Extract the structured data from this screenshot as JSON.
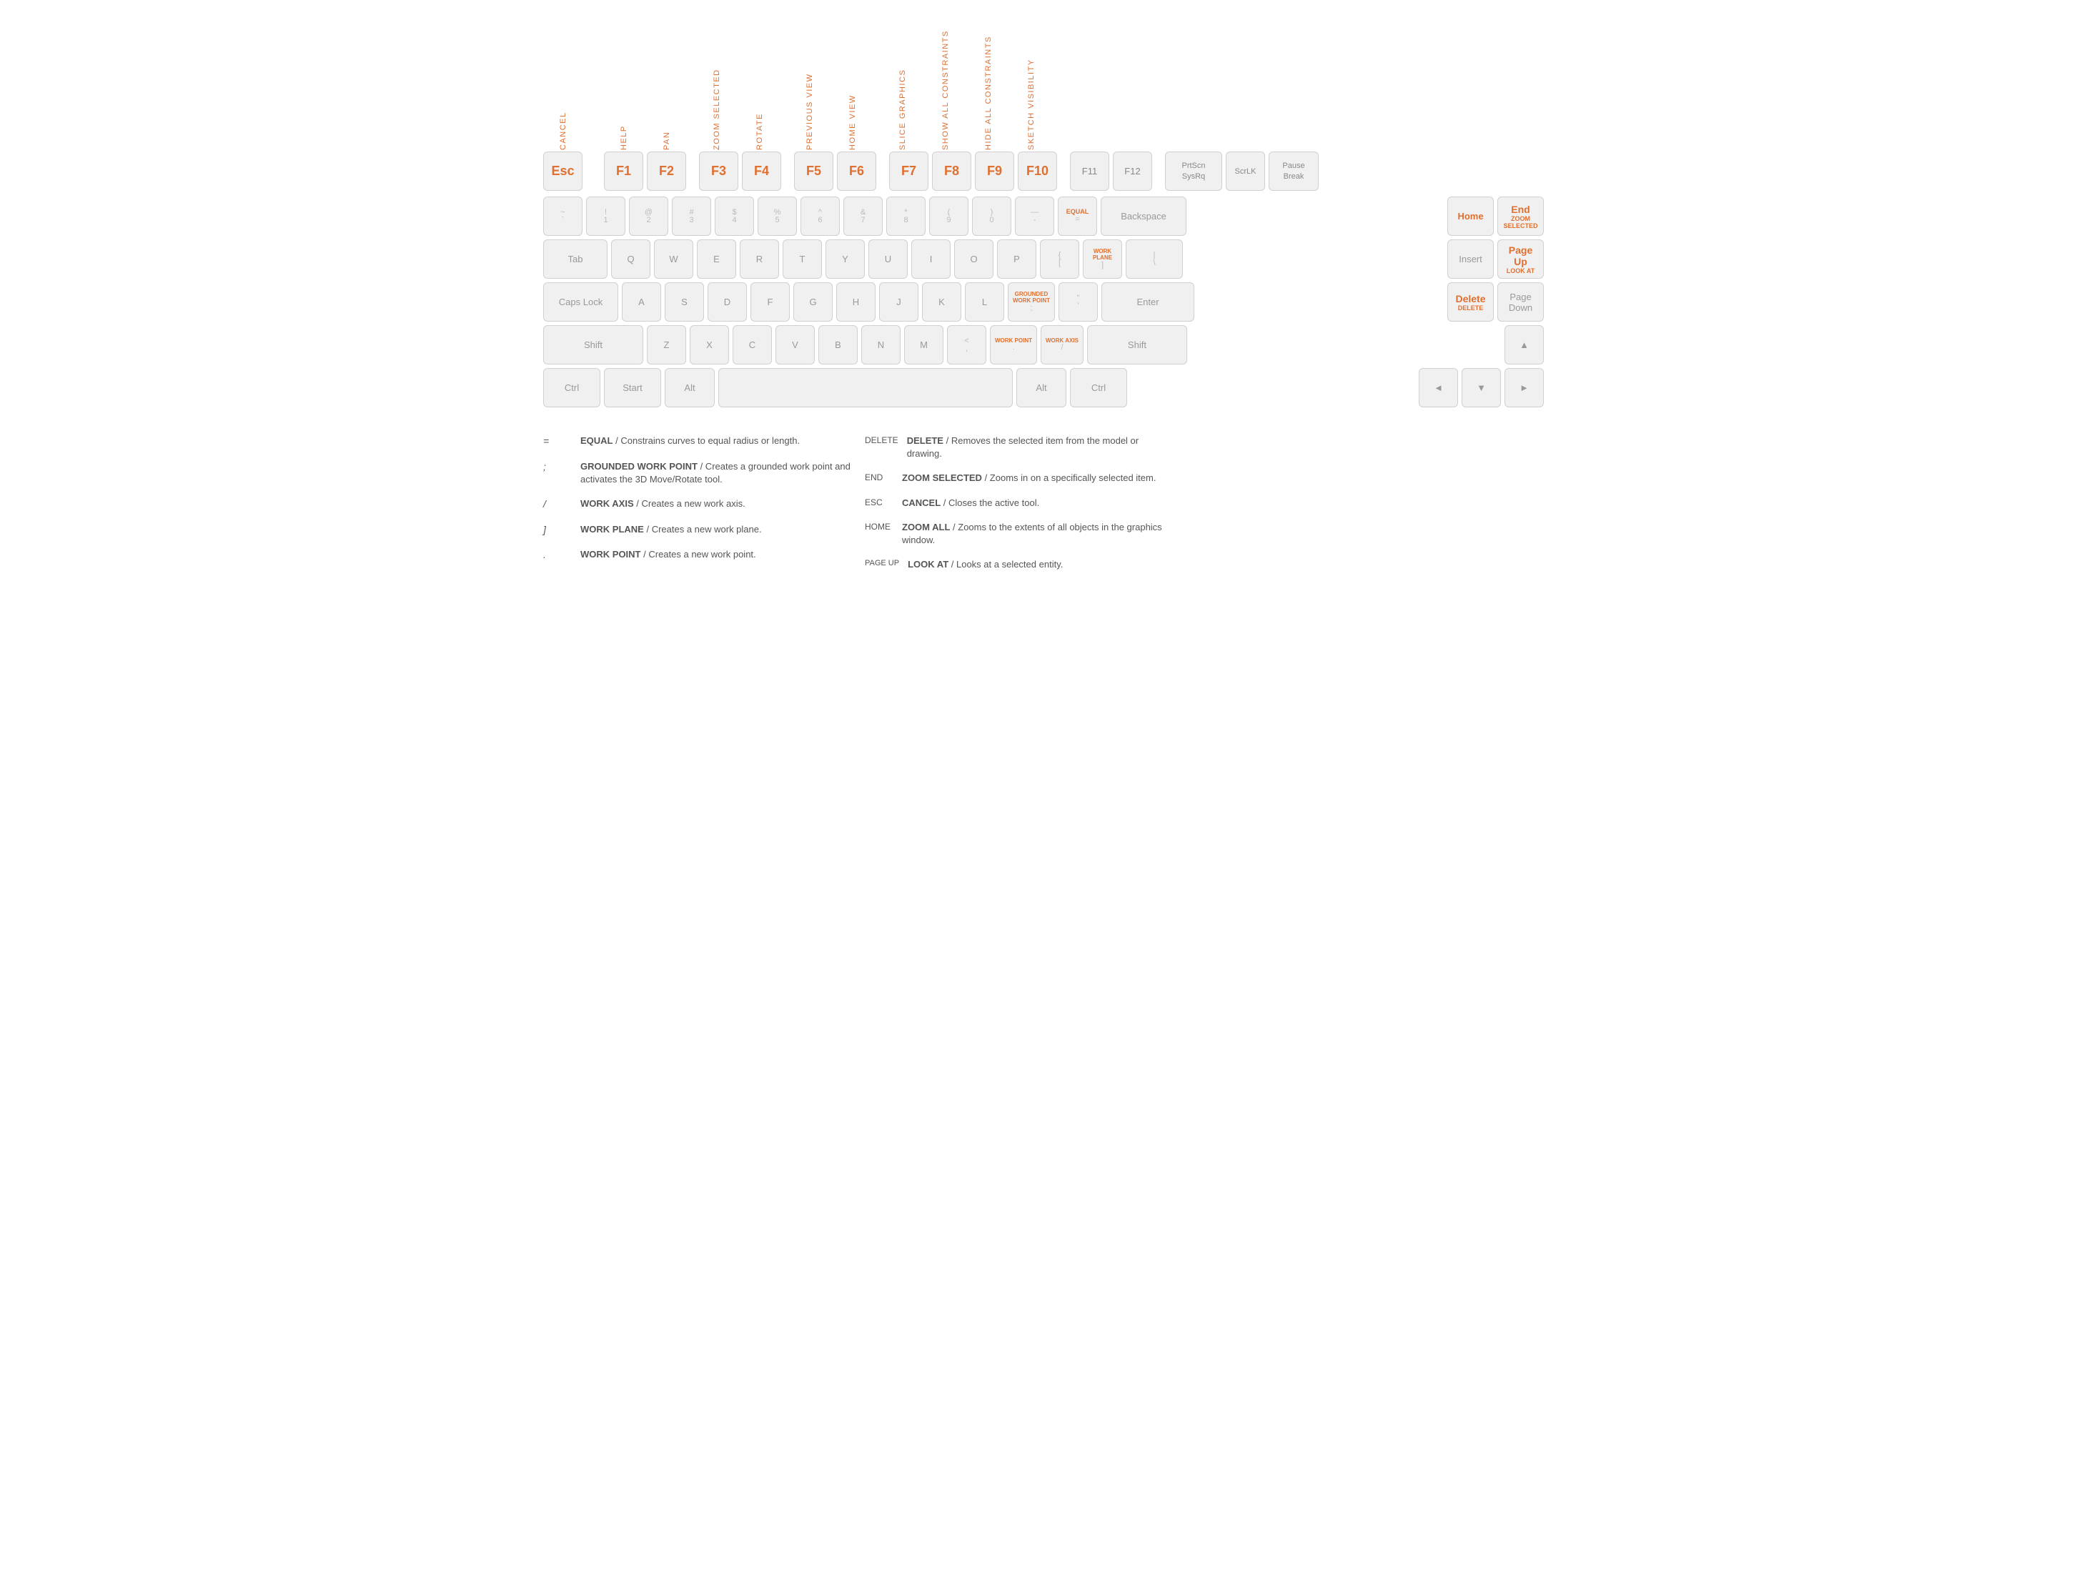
{
  "keyboard": {
    "fn_labels": [
      {
        "key": "esc",
        "label": "CANCEL",
        "offset": 0
      },
      {
        "key": "f1",
        "label": "HELP"
      },
      {
        "key": "f2",
        "label": "PAN"
      },
      {
        "key": "f3",
        "label": "ZOOM SELECTED"
      },
      {
        "key": "f4",
        "label": "ROTATE"
      },
      {
        "key": "f5",
        "label": "PREVIOUS VIEW"
      },
      {
        "key": "f6",
        "label": "HOME VIEW"
      },
      {
        "key": "f7",
        "label": "SLICE GRAPHICS"
      },
      {
        "key": "f8",
        "label": "SHOW ALL CONSTRAINTS"
      },
      {
        "key": "f9",
        "label": "HIDE ALL CONSTRAINTS"
      },
      {
        "key": "f10",
        "label": "SKETCH VISIBILITY"
      }
    ],
    "rows": {
      "function": [
        {
          "id": "esc",
          "label": "Esc",
          "orange": true
        },
        {
          "id": "f1",
          "label": "F1",
          "orange": true
        },
        {
          "id": "f2",
          "label": "F2",
          "orange": true
        },
        {
          "id": "f3",
          "label": "F3",
          "orange": true
        },
        {
          "id": "f4",
          "label": "F4",
          "orange": true
        },
        {
          "id": "f5",
          "label": "F5",
          "orange": true
        },
        {
          "id": "f6",
          "label": "F6",
          "orange": true
        },
        {
          "id": "f7",
          "label": "F7",
          "orange": true
        },
        {
          "id": "f8",
          "label": "F8",
          "orange": true
        },
        {
          "id": "f9",
          "label": "F9",
          "orange": true
        },
        {
          "id": "f10",
          "label": "F10",
          "orange": true
        },
        {
          "id": "f11",
          "label": "F11",
          "orange": false
        },
        {
          "id": "f12",
          "label": "F12",
          "orange": false
        },
        {
          "id": "prtscn",
          "label": "PrtScn\nSysRq",
          "orange": false,
          "wide": true
        },
        {
          "id": "scrlk",
          "label": "ScrLK",
          "orange": false
        },
        {
          "id": "pause",
          "label": "Pause\nBreak",
          "orange": false
        }
      ],
      "number": [
        {
          "id": "tilde",
          "top": "~",
          "bot": "`"
        },
        {
          "id": "1",
          "top": "!",
          "bot": "1"
        },
        {
          "id": "2",
          "top": "@",
          "bot": "2"
        },
        {
          "id": "3",
          "top": "#",
          "bot": "3"
        },
        {
          "id": "4",
          "top": "$",
          "bot": "4"
        },
        {
          "id": "5",
          "top": "%",
          "bot": "5"
        },
        {
          "id": "6",
          "top": "^",
          "bot": "6"
        },
        {
          "id": "7",
          "top": "&",
          "bot": "7"
        },
        {
          "id": "8",
          "top": "*",
          "bot": "8"
        },
        {
          "id": "9",
          "top": "(",
          "bot": "9"
        },
        {
          "id": "0",
          "top": ")",
          "bot": "0"
        },
        {
          "id": "minus",
          "top": "—",
          "bot": "-"
        },
        {
          "id": "equal",
          "top": "EQUAL",
          "bot": "=",
          "topOrange": true
        },
        {
          "id": "backspace",
          "label": "Backspace",
          "wide": true
        }
      ],
      "tab": [
        {
          "id": "tab",
          "label": "Tab",
          "wide": true
        },
        {
          "id": "q",
          "label": "Q"
        },
        {
          "id": "w",
          "label": "W"
        },
        {
          "id": "e",
          "label": "E"
        },
        {
          "id": "r",
          "label": "R"
        },
        {
          "id": "t",
          "label": "T"
        },
        {
          "id": "y",
          "label": "Y"
        },
        {
          "id": "u",
          "label": "U"
        },
        {
          "id": "i",
          "label": "I"
        },
        {
          "id": "o",
          "label": "O"
        },
        {
          "id": "p",
          "label": "P"
        },
        {
          "id": "bracketl",
          "label": "[",
          "top": "{"
        },
        {
          "id": "bracketr",
          "label": "]",
          "top": "WORK\nPLANE",
          "topOrange": true
        },
        {
          "id": "backslash",
          "label": "\\",
          "top": "|"
        }
      ],
      "caps": [
        {
          "id": "capslock",
          "label": "Caps Lock",
          "wide": true,
          "extraWide": true
        },
        {
          "id": "a",
          "label": "A"
        },
        {
          "id": "s",
          "label": "S"
        },
        {
          "id": "d",
          "label": "D"
        },
        {
          "id": "f",
          "label": "F"
        },
        {
          "id": "g",
          "label": "G"
        },
        {
          "id": "h",
          "label": "H"
        },
        {
          "id": "j",
          "label": "J"
        },
        {
          "id": "k",
          "label": "K"
        },
        {
          "id": "l",
          "label": "L"
        },
        {
          "id": "semi",
          "label": ";",
          "top": "GROUNDED\nWORK POINT",
          "topOrange": true
        },
        {
          "id": "quote",
          "label": "\"",
          "top": "'"
        },
        {
          "id": "enter",
          "label": "Enter",
          "wide": true,
          "extraWide": true
        }
      ],
      "shift": [
        {
          "id": "shiftl",
          "label": "Shift",
          "wide": true,
          "extraWide": true
        },
        {
          "id": "z",
          "label": "Z"
        },
        {
          "id": "x",
          "label": "X"
        },
        {
          "id": "c",
          "label": "C"
        },
        {
          "id": "v",
          "label": "V"
        },
        {
          "id": "b",
          "label": "B"
        },
        {
          "id": "n",
          "label": "N"
        },
        {
          "id": "m",
          "label": "M"
        },
        {
          "id": "comma",
          "label": ",",
          "top": "<"
        },
        {
          "id": "period",
          "label": ".",
          "top": "WORK POINT",
          "topOrange": true
        },
        {
          "id": "slash",
          "label": "/",
          "top": "WORK AXIS",
          "topOrange": true
        },
        {
          "id": "shiftr",
          "label": "Shift",
          "wide": true,
          "extraWide": true
        }
      ],
      "bottom": [
        {
          "id": "ctrl",
          "label": "Ctrl",
          "wide": true
        },
        {
          "id": "start",
          "label": "Start",
          "wide": true
        },
        {
          "id": "alt",
          "label": "Alt",
          "wide": true
        },
        {
          "id": "space",
          "label": "",
          "space": true
        },
        {
          "id": "altr",
          "label": "Alt",
          "wide": true
        },
        {
          "id": "ctrlr",
          "label": "Ctrl",
          "wide": true
        }
      ]
    },
    "right_cluster": {
      "top_row": [
        {
          "id": "home",
          "label": "Home",
          "orange": true
        },
        {
          "id": "end",
          "label": "End",
          "sub": "ZOOM\nSELECTED",
          "orange": true
        }
      ],
      "mid_row": [
        {
          "id": "insert",
          "label": "Insert"
        },
        {
          "id": "pageup",
          "label": "Page\nUp",
          "sub": "LOOK AT",
          "orange": true
        }
      ],
      "low_row": [
        {
          "id": "delete",
          "label": "Delete",
          "sub": "DELETE",
          "orange": true
        },
        {
          "id": "pagedown",
          "label": "Page\nDown"
        }
      ]
    },
    "arrows": {
      "up": "▲",
      "left": "◄",
      "down": "▼",
      "right": "►"
    }
  },
  "legend": {
    "left": [
      {
        "key": "=",
        "title": "EQUAL",
        "desc": "/ Constrains curves to equal radius or length."
      },
      {
        "key": ";",
        "title": "GROUNDED WORK POINT",
        "desc": "/ Creates a grounded work point and activates the 3D Move/Rotate tool."
      },
      {
        "key": "/",
        "title": "WORK AXIS",
        "desc": "/ Creates a new work axis."
      },
      {
        "key": "]",
        "title": "WORK PLANE",
        "desc": "/ Creates a new work plane."
      },
      {
        "key": ".",
        "title": "WORK POINT",
        "desc": "/ Creates a new work point."
      }
    ],
    "right": [
      {
        "key": "DELETE",
        "title": "DELETE",
        "desc": "/ Removes the selected item from the model or drawing."
      },
      {
        "key": "END",
        "title": "ZOOM SELECTED",
        "desc": "/ Zooms in on a specifically selected item."
      },
      {
        "key": "ESC",
        "title": "CANCEL",
        "desc": "/ Closes the active tool."
      },
      {
        "key": "HOME",
        "title": "ZOOM ALL",
        "desc": "/ Zooms to the extents of all objects in the graphics window."
      },
      {
        "key": "PAGE UP",
        "title": "LOOK AT",
        "desc": "/ Looks at a selected entity."
      }
    ]
  }
}
